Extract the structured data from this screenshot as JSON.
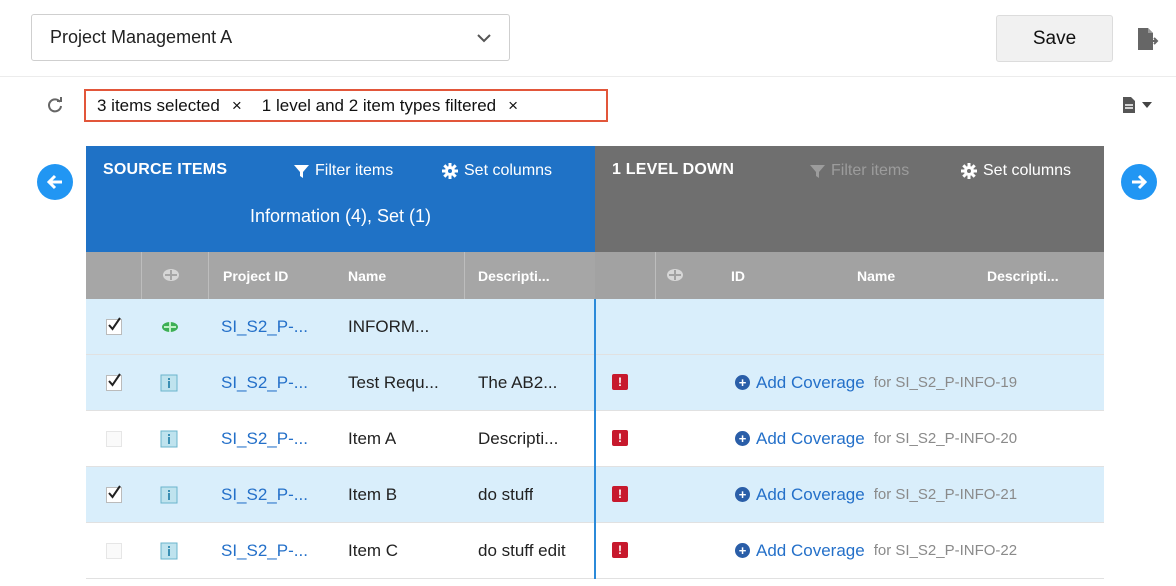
{
  "project": {
    "selected": "Project Management A"
  },
  "toolbar": {
    "save_label": "Save"
  },
  "filters": {
    "chips": [
      {
        "label": "3 items selected",
        "remove": "×"
      },
      {
        "label": "1 level and 2 item types filtered",
        "remove": "×"
      }
    ]
  },
  "source": {
    "title": "SOURCE ITEMS",
    "filter_label": "Filter items",
    "columns_label": "Set columns",
    "group_label": "Information (4), Set (1)",
    "columns": [
      "Project ID",
      "Name",
      "Descripti..."
    ]
  },
  "level": {
    "title": "1 LEVEL DOWN",
    "filter_label": "Filter items",
    "columns_label": "Set columns",
    "columns": [
      "ID",
      "Name",
      "Descripti..."
    ]
  },
  "rows": [
    {
      "checked": true,
      "type": "set",
      "pid": "SI_S2_P-...",
      "name": "INFORM...",
      "desc": "",
      "warn": false,
      "coverage": "",
      "coverage_for": ""
    },
    {
      "checked": true,
      "type": "info",
      "pid": "SI_S2_P-...",
      "name": "Test Requ...",
      "desc": "The AB2...",
      "warn": true,
      "coverage": "Add Coverage",
      "coverage_for": "for SI_S2_P-INFO-19"
    },
    {
      "checked": false,
      "type": "info",
      "pid": "SI_S2_P-...",
      "name": "Item A",
      "desc": "Descripti...",
      "warn": true,
      "coverage": "Add Coverage",
      "coverage_for": "for SI_S2_P-INFO-20"
    },
    {
      "checked": true,
      "type": "info",
      "pid": "SI_S2_P-...",
      "name": "Item B",
      "desc": "do stuff",
      "warn": true,
      "coverage": "Add Coverage",
      "coverage_for": "for SI_S2_P-INFO-21"
    },
    {
      "checked": false,
      "type": "info",
      "pid": "SI_S2_P-...",
      "name": "Item C",
      "desc": "do stuff edit",
      "warn": true,
      "coverage": "Add Coverage",
      "coverage_for": "for SI_S2_P-INFO-22"
    }
  ],
  "icons": {
    "export": "export-icon",
    "refresh": "refresh-icon",
    "doc_menu": "document-menu-icon",
    "prev": "arrow-left-icon",
    "next": "arrow-right-icon",
    "filter": "filter-icon",
    "gear": "gear-icon",
    "warning": "warning-icon",
    "add": "plus-circle-icon"
  },
  "colors": {
    "source_header": "#1f72c6",
    "level_header": "#6f6f6f",
    "selected_row": "#d9eefb",
    "link": "#2470c9",
    "filter_outline": "#e2563a",
    "warning": "#c7192d",
    "nav_arrow": "#2196f3"
  }
}
